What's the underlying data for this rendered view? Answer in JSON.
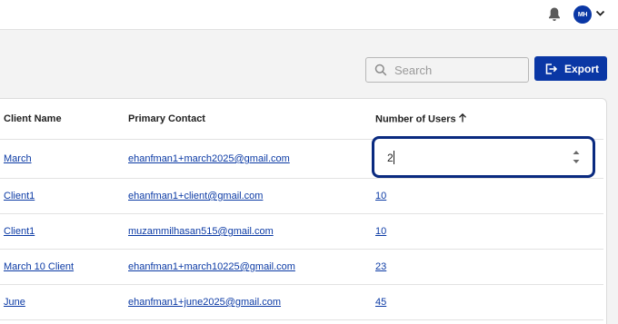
{
  "header": {
    "avatar_initials": "MH",
    "icons": [
      "bell-icon",
      "chevron-down-icon"
    ]
  },
  "toolbar": {
    "search_placeholder": "Search",
    "export_label": "Export"
  },
  "table": {
    "columns": [
      "Client Name",
      "Primary Contact",
      "Number of Users"
    ],
    "sort": {
      "column": "Number of Users",
      "direction": "ascending"
    },
    "editing": {
      "row": 0,
      "value": "2"
    },
    "rows": [
      {
        "client": "March",
        "contact": "ehanfman1+march2025@gmail.com",
        "users": "2"
      },
      {
        "client": "Client1",
        "contact": "ehanfman1+client@gmail.com",
        "users": "10"
      },
      {
        "client": "Client1",
        "contact": "muzammilhasan515@gmail.com",
        "users": "10"
      },
      {
        "client": "March 10 Client",
        "contact": "ehanfman1+march10225@gmail.com",
        "users": "23"
      },
      {
        "client": "June",
        "contact": "ehanfman1+june2025@gmail.com",
        "users": "45"
      }
    ]
  },
  "colors": {
    "brand": "#0a37a5",
    "link": "#0b3aa5",
    "focus_border": "#0a2a80"
  }
}
